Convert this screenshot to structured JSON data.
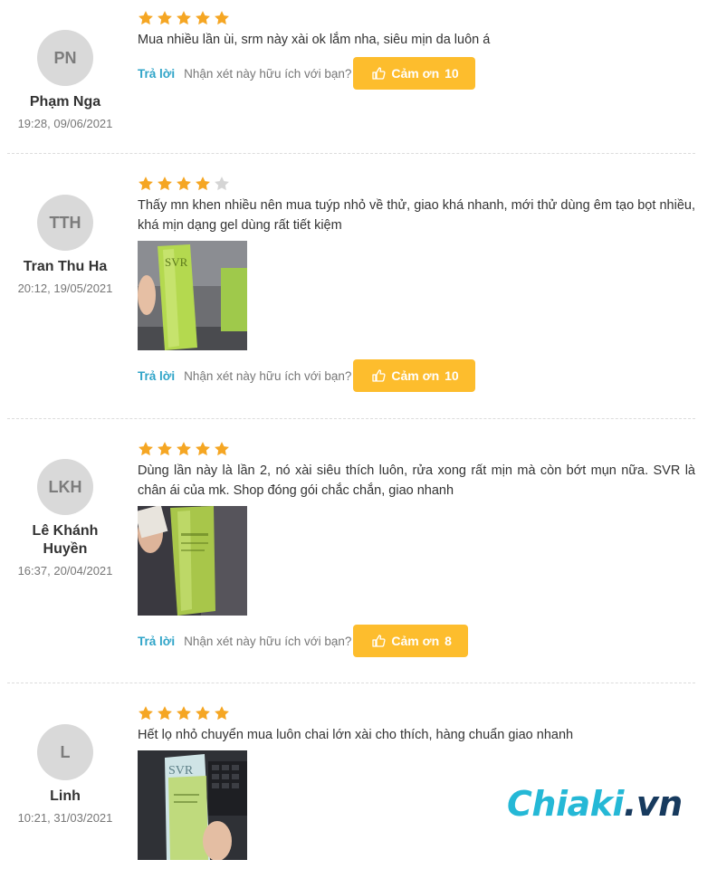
{
  "reviews": [
    {
      "initials": "PN",
      "name": "Phạm Nga",
      "date": "19:28, 09/06/2021",
      "rating": 5,
      "text": "Mua nhiều lần ùi, srm này xài ok lắm nha, siêu mịn da luôn á",
      "has_photo": false,
      "reply_label": "Trả lời",
      "helpful_label": "Nhận xét này hữu ích với bạn?",
      "thanks_label": "Cảm ơn",
      "thanks_count": "10"
    },
    {
      "initials": "TTH",
      "name": "Tran Thu Ha",
      "date": "20:12, 19/05/2021",
      "rating": 4,
      "text": "Thấy mn khen nhiều nên mua tuýp nhỏ về thử, giao khá nhanh, mới thử dùng êm tạo bọt nhiều, khá mịn dạng gel dùng rất tiết kiệm",
      "has_photo": true,
      "reply_label": "Trả lời",
      "helpful_label": "Nhận xét này hữu ích với bạn?",
      "thanks_label": "Cảm ơn",
      "thanks_count": "10"
    },
    {
      "initials": "LKH",
      "name": "Lê Khánh Huyền",
      "date": "16:37, 20/04/2021",
      "rating": 5,
      "text": "Dùng lần này là lần 2, nó xài siêu thích luôn, rửa xong rất mịn mà còn bớt mụn nữa. SVR là chân ái của mk. Shop đóng gói chắc chắn, giao nhanh",
      "has_photo": true,
      "reply_label": "Trả lời",
      "helpful_label": "Nhận xét này hữu ích với bạn?",
      "thanks_label": "Cảm ơn",
      "thanks_count": "8"
    },
    {
      "initials": "L",
      "name": "Linh",
      "date": "10:21, 31/03/2021",
      "rating": 5,
      "text": "Hết lọ nhỏ chuyển mua luôn chai lớn xài cho thích, hàng chuẩn giao nhanh",
      "has_photo": true,
      "reply_label": "",
      "helpful_label": "",
      "thanks_label": "",
      "thanks_count": ""
    }
  ],
  "photo_brand": "SVR",
  "watermark": {
    "part1": "Chiaki",
    "part2": ".vn"
  },
  "colors": {
    "star_on": "#f5a623",
    "star_off": "#d5d5d5",
    "button": "#fdbd2d",
    "reply_link": "#2fa4c8",
    "avatar_bg": "#d9d9d9",
    "watermark_primary": "#25b8d6",
    "watermark_secondary": "#173a5e"
  }
}
